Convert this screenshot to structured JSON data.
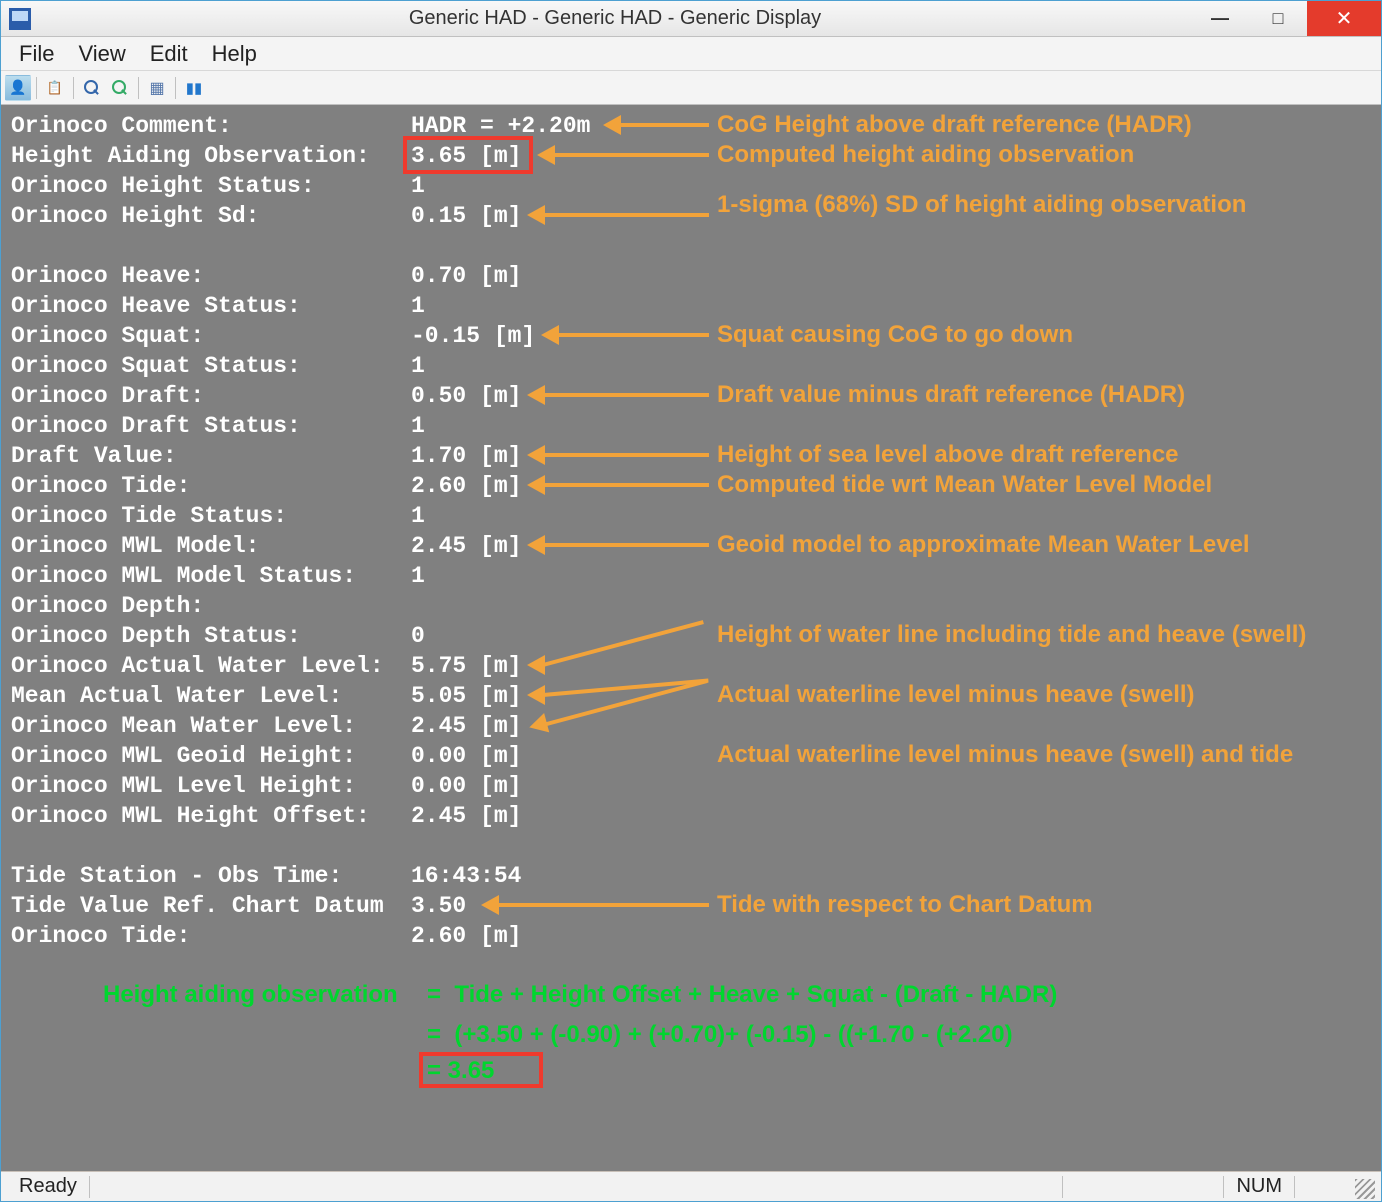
{
  "window": {
    "title": "Generic HAD - Generic HAD  - Generic Display",
    "min": "—",
    "max": "▢",
    "close": "✕"
  },
  "menu": {
    "file": "File",
    "view": "View",
    "edit": "Edit",
    "help": "Help"
  },
  "status": {
    "ready": "Ready",
    "num": "NUM"
  },
  "rows": {
    "r0_l": "Orinoco Comment:",
    "r0_v": "HADR = +2.20m",
    "r1_l": "Height Aiding Observation:",
    "r1_v": "3.65 [m]",
    "r2_l": "Orinoco Height Status:",
    "r2_v": "1",
    "r3_l": "Orinoco Height Sd:",
    "r3_v": "0.15 [m]",
    "r4_l": "Orinoco Heave:",
    "r4_v": "0.70 [m]",
    "r5_l": "Orinoco Heave Status:",
    "r5_v": "1",
    "r6_l": "Orinoco Squat:",
    "r6_v": "-0.15 [m]",
    "r7_l": "Orinoco Squat Status:",
    "r7_v": "1",
    "r8_l": "Orinoco Draft:",
    "r8_v": "0.50 [m]",
    "r9_l": "Orinoco Draft Status:",
    "r9_v": "1",
    "r10_l": "Draft Value:",
    "r10_v": "1.70 [m]",
    "r11_l": "Orinoco Tide:",
    "r11_v": "2.60 [m]",
    "r12_l": "Orinoco Tide Status:",
    "r12_v": "1",
    "r13_l": "Orinoco MWL Model:",
    "r13_v": "2.45 [m]",
    "r14_l": "Orinoco MWL Model Status:",
    "r14_v": "1",
    "r15_l": "Orinoco Depth:",
    "r15_v": "",
    "r16_l": "Orinoco Depth Status:",
    "r16_v": "0",
    "r17_l": "Orinoco Actual Water Level:",
    "r17_v": "5.75 [m]",
    "r18_l": "Mean Actual Water Level:",
    "r18_v": "5.05 [m]",
    "r19_l": "Orinoco Mean Water Level:",
    "r19_v": "2.45 [m]",
    "r20_l": "Orinoco MWL Geoid Height:",
    "r20_v": "0.00 [m]",
    "r21_l": "Orinoco MWL Level Height:",
    "r21_v": "0.00 [m]",
    "r22_l": "Orinoco MWL Height Offset:",
    "r22_v": "2.45 [m]",
    "r23_l": "Tide Station - Obs Time:",
    "r23_v": "16:43:54",
    "r24_l": "Tide Value Ref. Chart Datum",
    "r24_v": "3.50",
    "r25_l": "Orinoco Tide:",
    "r25_v": "2.60 [m]"
  },
  "annots": {
    "a0": "CoG Height above draft reference  (HADR)",
    "a1": "Computed height aiding observation",
    "a2": "1-sigma (68%) SD of height aiding observation",
    "a3": "Squat causing CoG to go down",
    "a4": "Draft value minus draft reference (HADR)",
    "a5": "Height of sea level above draft reference",
    "a6": "Computed tide wrt Mean Water Level Model",
    "a7": "Geoid model to approximate Mean Water Level",
    "a8": "Height of water line including tide and heave (swell)",
    "a9": "Actual waterline level minus heave (swell)",
    "a10": "Actual waterline level minus heave (swell)  and tide",
    "a11": "Tide with respect to Chart Datum"
  },
  "formula": {
    "f_l": "Height aiding observation",
    "f1": "=  Tide + Height Offset + Heave + Squat - (Draft - HADR)",
    "f2": "=  (+3.50 + (-0.90) + (+0.70)+ (-0.15) - ((+1.70 - (+2.20)",
    "f3": "= 3.65"
  }
}
